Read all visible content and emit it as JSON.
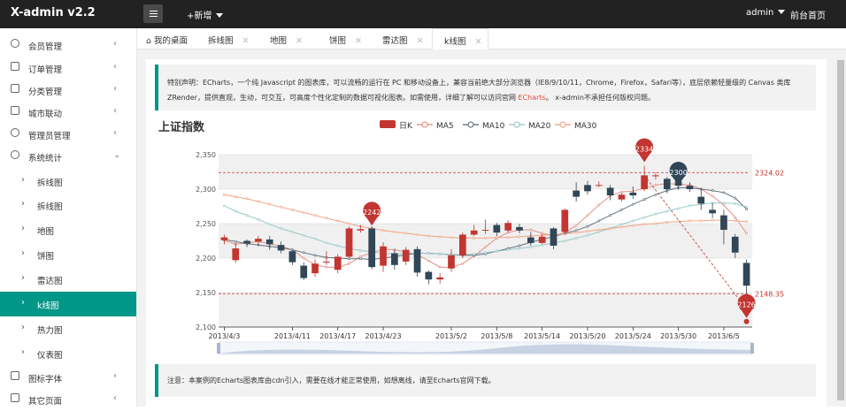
{
  "header": {
    "logo": "X-admin v2.2",
    "add_label": "+新增",
    "user": "admin",
    "front_page": "前台首页"
  },
  "sidebar": {
    "items": [
      {
        "label": "会员管理",
        "icon": "user-icon"
      },
      {
        "label": "订单管理",
        "icon": "order-icon"
      },
      {
        "label": "分类管理",
        "icon": "category-icon"
      },
      {
        "label": "城市联动",
        "icon": "city-icon"
      },
      {
        "label": "管理员管理",
        "icon": "admin-icon"
      },
      {
        "label": "系统统计",
        "icon": "stats-icon"
      }
    ],
    "subitems": [
      "拆线图",
      "拆线图",
      "地图",
      "饼图",
      "雷达图",
      "k线图",
      "热力图",
      "仪表图"
    ],
    "bottom": [
      {
        "label": "图标字体",
        "icon": "font-icon"
      },
      {
        "label": "其它页面",
        "icon": "page-icon"
      }
    ]
  },
  "tabs": [
    {
      "label": "我的桌面"
    },
    {
      "label": "拆线图"
    },
    {
      "label": "地图"
    },
    {
      "label": "饼图"
    },
    {
      "label": "雷达图"
    },
    {
      "label": "k线图"
    }
  ],
  "notice": {
    "prefix": "特别声明：ECharts，一个纯 Javascript 的图表库，可以流畅的运行在 PC 和移动设备上，兼容当前绝大部分浏览器（IE8/9/10/11，Chrome，Firefox，Safari等），底层依赖轻量级的 Canvas 类库 ZRender，提供直观，生动，可交互，可高度个性化定制的数据可视化图表。如需使用，详细了解可以访问官网 ",
    "link": "ECharts",
    "suffix": "。 x-admin不承担任何版权问题。"
  },
  "note": "注意：本案例的Echarts图表库由cdn引入，需要在线才能正常使用，如想离线，请至Echarts官网下载。",
  "colors": {
    "accent": "#009688",
    "up": "#c23531",
    "down": "#314656",
    "ma5": "#e0877a",
    "ma10": "#556470",
    "ma20": "#8fc3c4",
    "ma30": "#ee9b78"
  },
  "chart_data": {
    "type": "candlestick",
    "title": "上证指数",
    "legend": [
      "日K",
      "MA5",
      "MA10",
      "MA20",
      "MA30"
    ],
    "x_ticks": [
      "2013/4/3",
      "2013/4/11",
      "2013/4/17",
      "2013/4/23",
      "2013/5/2",
      "2013/5/8",
      "2013/5/14",
      "2013/5/20",
      "2013/5/24",
      "2013/5/30",
      "2013/6/5"
    ],
    "ylim": [
      2100,
      2350
    ],
    "y_ticks": [
      "2,100",
      "2,150",
      "2,200",
      "2,250",
      "2,300",
      "2,350"
    ],
    "candles": [
      [
        2226,
        2230,
        2220,
        2234
      ],
      [
        2197,
        2214,
        2193,
        2222
      ],
      [
        2225,
        2221,
        2216,
        2227
      ],
      [
        2224,
        2228,
        2218,
        2232
      ],
      [
        2227,
        2220,
        2212,
        2232
      ],
      [
        2219,
        2211,
        2207,
        2224
      ],
      [
        2210,
        2194,
        2190,
        2212
      ],
      [
        2189,
        2171,
        2168,
        2194
      ],
      [
        2178,
        2192,
        2173,
        2198
      ],
      [
        2194,
        2195,
        2190,
        2210
      ],
      [
        2183,
        2202,
        2178,
        2206
      ],
      [
        2202,
        2243,
        2200,
        2246
      ],
      [
        2240,
        2242,
        2237,
        2248
      ],
      [
        2243,
        2187,
        2184,
        2246
      ],
      [
        2189,
        2217,
        2180,
        2223
      ],
      [
        2207,
        2190,
        2183,
        2213
      ],
      [
        2195,
        2212,
        2190,
        2216
      ],
      [
        2213,
        2179,
        2173,
        2217
      ],
      [
        2180,
        2169,
        2162,
        2182
      ],
      [
        2169,
        2172,
        2163,
        2178
      ],
      [
        2185,
        2204,
        2180,
        2213
      ],
      [
        2204,
        2234,
        2200,
        2237
      ],
      [
        2234,
        2240,
        2232,
        2248
      ],
      [
        2240,
        2241,
        2235,
        2256
      ],
      [
        2248,
        2237,
        2232,
        2251
      ],
      [
        2240,
        2251,
        2237,
        2255
      ],
      [
        2245,
        2240,
        2236,
        2250
      ],
      [
        2230,
        2222,
        2218,
        2238
      ],
      [
        2222,
        2231,
        2220,
        2235
      ],
      [
        2243,
        2218,
        2213,
        2245
      ],
      [
        2238,
        2270,
        2234,
        2272
      ],
      [
        2298,
        2289,
        2282,
        2310
      ],
      [
        2306,
        2297,
        2292,
        2312
      ],
      [
        2306,
        2306,
        2303,
        2311
      ],
      [
        2302,
        2291,
        2284,
        2306
      ],
      [
        2285,
        2292,
        2282,
        2295
      ],
      [
        2295,
        2291,
        2286,
        2304
      ],
      [
        2300,
        2320,
        2297,
        2334
      ],
      [
        2320,
        2320,
        2314,
        2324
      ],
      [
        2315,
        2300,
        2294,
        2318
      ],
      [
        2311,
        2305,
        2299,
        2316
      ],
      [
        2305,
        2300,
        2296,
        2310
      ],
      [
        2289,
        2279,
        2270,
        2302
      ],
      [
        2270,
        2265,
        2258,
        2280
      ],
      [
        2262,
        2241,
        2220,
        2270
      ],
      [
        2231,
        2208,
        2200,
        2235
      ],
      [
        2193,
        2160,
        2148,
        2198
      ]
    ],
    "series": [
      {
        "name": "MA5",
        "values": [
          2226,
          2220,
          2222,
          2224,
          2221,
          2217,
          2212,
          2200,
          2190,
          2187,
          2186,
          2192,
          2202,
          2208,
          2213,
          2212,
          2209,
          2205,
          2196,
          2187,
          2186,
          2192,
          2203,
          2216,
          2229,
          2237,
          2241,
          2241,
          2236,
          2232,
          2237,
          2247,
          2262,
          2277,
          2290,
          2296,
          2297,
          2301,
          2306,
          2308,
          2307,
          2306,
          2300,
          2290,
          2277,
          2259,
          2236
        ]
      },
      {
        "name": "MA10",
        "values": [
          2227,
          2224,
          2221,
          2219,
          2217,
          2215,
          2212,
          2208,
          2204,
          2201,
          2200,
          2199,
          2199,
          2198,
          2200,
          2202,
          2205,
          2207,
          2207,
          2206,
          2205,
          2204,
          2204,
          2206,
          2210,
          2214,
          2218,
          2223,
          2227,
          2231,
          2236,
          2240,
          2246,
          2254,
          2262,
          2270,
          2278,
          2285,
          2292,
          2298,
          2302,
          2302,
          2300,
          2298,
          2295,
          2287,
          2271
        ]
      },
      {
        "name": "MA20",
        "values": [
          2276,
          2268,
          2262,
          2256,
          2249,
          2243,
          2238,
          2233,
          2228,
          2222,
          2218,
          2214,
          2211,
          2209,
          2207,
          2206,
          2207,
          2207,
          2207,
          2206,
          2205,
          2205,
          2206,
          2208,
          2210,
          2212,
          2214,
          2216,
          2219,
          2222,
          2225,
          2229,
          2233,
          2238,
          2243,
          2249,
          2254,
          2259,
          2264,
          2268,
          2272,
          2276,
          2278,
          2280,
          2280,
          2279,
          2274
        ]
      },
      {
        "name": "MA30",
        "values": [
          2292,
          2289,
          2286,
          2282,
          2278,
          2274,
          2270,
          2266,
          2262,
          2258,
          2254,
          2250,
          2246,
          2243,
          2240,
          2238,
          2236,
          2234,
          2232,
          2231,
          2230,
          2229,
          2229,
          2229,
          2230,
          2230,
          2231,
          2232,
          2233,
          2234,
          2235,
          2237,
          2239,
          2241,
          2243,
          2245,
          2247,
          2249,
          2250,
          2252,
          2253,
          2254,
          2254,
          2255,
          2255,
          2254,
          2253
        ]
      }
    ],
    "markers": [
      {
        "label": "2242",
        "index": 13,
        "value": 2242,
        "kind": "max-local"
      },
      {
        "label": "2334",
        "index": 37,
        "value": 2334,
        "kind": "max"
      },
      {
        "label": "2300",
        "index": 40,
        "value": 2300,
        "kind": "mean"
      },
      {
        "label": "2126",
        "index": 46,
        "value": 2126,
        "kind": "min"
      }
    ],
    "mark_lines": [
      {
        "label": "2324.02",
        "value": 2324.02
      },
      {
        "label": "2148.35",
        "value": 2148.35
      }
    ]
  }
}
